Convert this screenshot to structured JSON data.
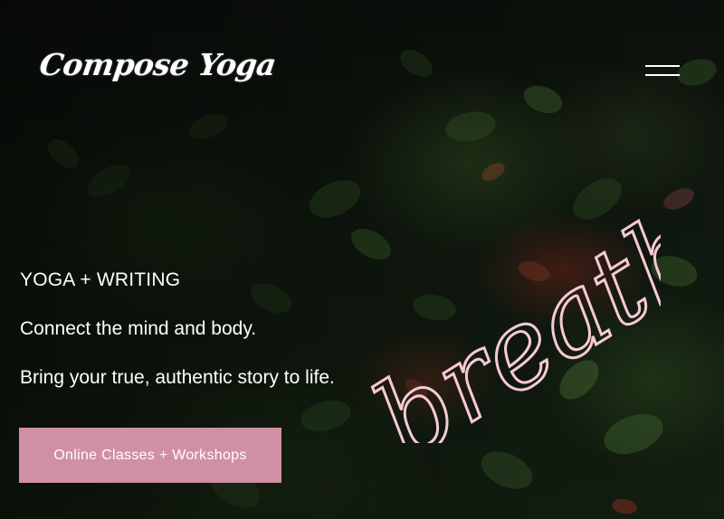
{
  "site": {
    "logo_text": "Compose Yoga"
  },
  "nav": {
    "menu_icon": "hamburger-menu-icon"
  },
  "hero": {
    "kicker": "YOGA + WRITING",
    "line1": "Connect the mind and body.",
    "line2": "Bring your true, authentic story to life.",
    "cta_label": "Online Classes + Workshops",
    "neon_text": "breathe"
  },
  "colors": {
    "accent": "#d08fa5",
    "neon": "#f6c9d6",
    "text": "#ffffff",
    "background": "#111a10"
  }
}
